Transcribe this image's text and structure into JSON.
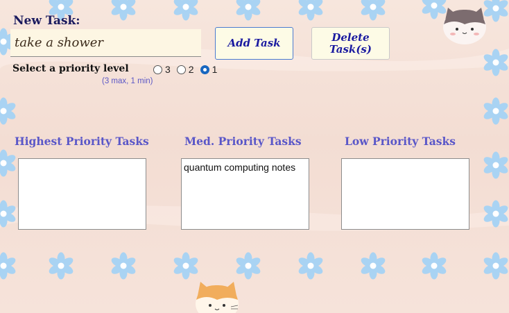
{
  "form": {
    "new_task_label": "New Task:",
    "task_input_value": "take a shower",
    "add_button": "Add Task",
    "delete_button_line1": "Delete",
    "delete_button_line2": "Task(s)",
    "priority_label": "Select a priority level",
    "priority_hint": "(3 max, 1 min)",
    "priority_options": [
      "3",
      "2",
      "1"
    ],
    "priority_selected": "1"
  },
  "columns": [
    {
      "title": "Highest Priority Tasks",
      "tasks": []
    },
    {
      "title": "Med. Priority Tasks",
      "tasks": [
        "quantum computing notes"
      ]
    },
    {
      "title": "Low Priority Tasks",
      "tasks": []
    }
  ],
  "decor": {
    "flower_color": "#a9d3f3",
    "flower_center": "#ffffff",
    "accent_text": "#5a57c8",
    "button_text": "#1a1aa0",
    "decorative_icons": [
      "flower-icon",
      "gray-cat-icon",
      "orange-cat-icon"
    ]
  }
}
